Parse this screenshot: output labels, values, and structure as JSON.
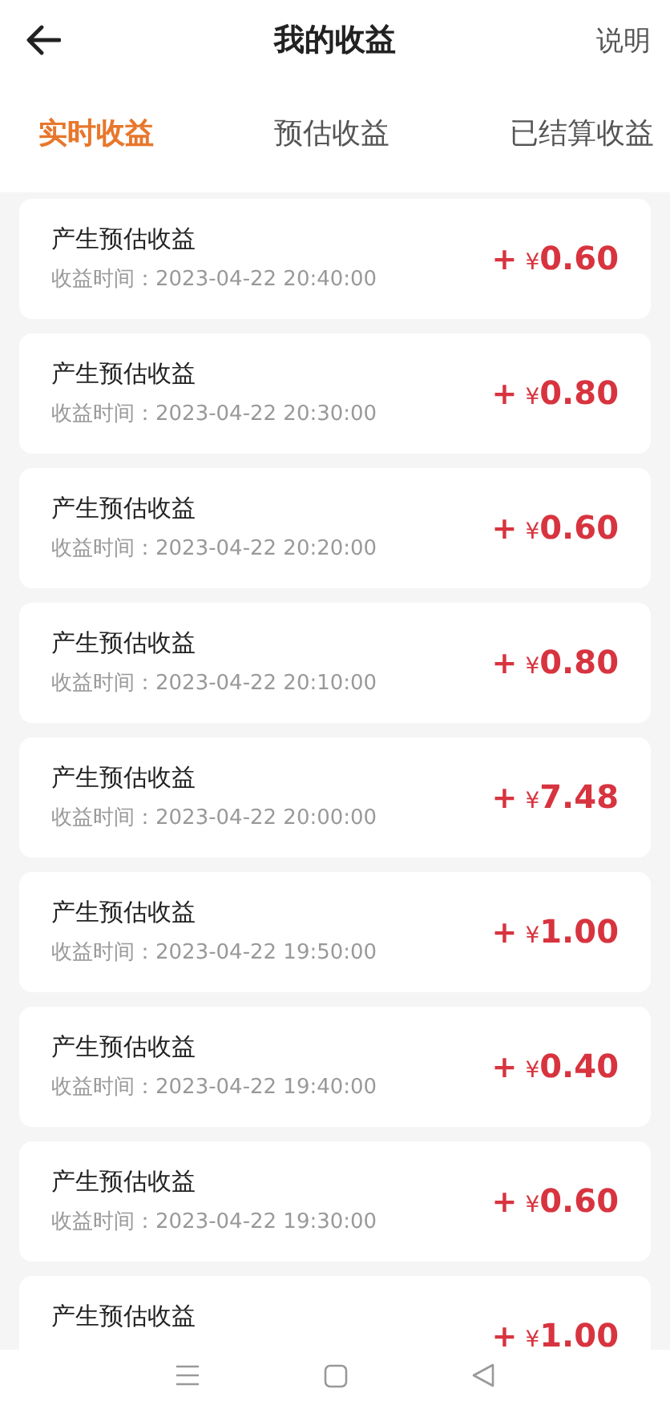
{
  "header": {
    "title": "我的收益",
    "action": "说明"
  },
  "tabs": [
    {
      "label": "实时收益",
      "selected": true
    },
    {
      "label": "预估收益",
      "selected": false
    },
    {
      "label": "已结算收益",
      "selected": false
    }
  ],
  "records": [
    {
      "title": "产生预估收益",
      "time": "收益时间：2023-04-22 20:40:00",
      "sign": "+",
      "currency": "¥",
      "value": "0.60"
    },
    {
      "title": "产生预估收益",
      "time": "收益时间：2023-04-22 20:30:00",
      "sign": "+",
      "currency": "¥",
      "value": "0.80"
    },
    {
      "title": "产生预估收益",
      "time": "收益时间：2023-04-22 20:20:00",
      "sign": "+",
      "currency": "¥",
      "value": "0.60"
    },
    {
      "title": "产生预估收益",
      "time": "收益时间：2023-04-22 20:10:00",
      "sign": "+",
      "currency": "¥",
      "value": "0.80"
    },
    {
      "title": "产生预估收益",
      "time": "收益时间：2023-04-22 20:00:00",
      "sign": "+",
      "currency": "¥",
      "value": "7.48"
    },
    {
      "title": "产生预估收益",
      "time": "收益时间：2023-04-22 19:50:00",
      "sign": "+",
      "currency": "¥",
      "value": "1.00"
    },
    {
      "title": "产生预估收益",
      "time": "收益时间：2023-04-22 19:40:00",
      "sign": "+",
      "currency": "¥",
      "value": "0.40"
    },
    {
      "title": "产生预估收益",
      "time": "收益时间：2023-04-22 19:30:00",
      "sign": "+",
      "currency": "¥",
      "value": "0.60"
    },
    {
      "title": "产生预估收益",
      "sign": "+",
      "currency": "¥",
      "value": "1.00"
    }
  ],
  "nav_bar": {
    "buttons": [
      {
        "kind": "menu"
      },
      {
        "kind": "home"
      },
      {
        "kind": "back"
      }
    ]
  }
}
